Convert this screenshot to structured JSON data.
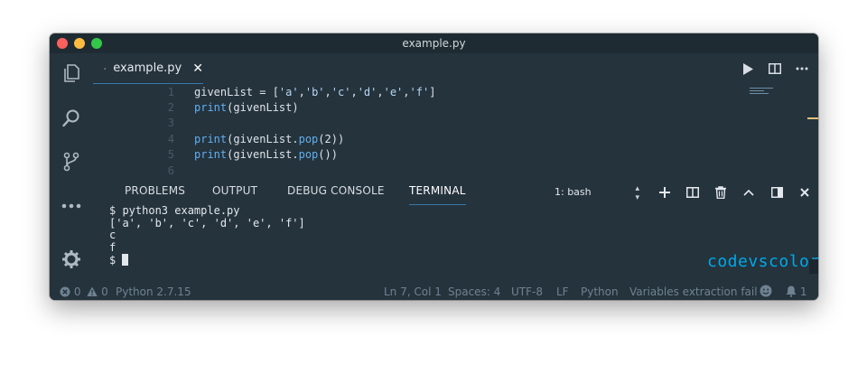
{
  "window": {
    "title": "example.py"
  },
  "tab": {
    "filename": "example.py",
    "close": "✕"
  },
  "editor": {
    "lines": [
      {
        "num": "1",
        "code": "givenList = ['a','b','c','d','e','f']"
      },
      {
        "num": "2",
        "code": "print(givenList)"
      },
      {
        "num": "3",
        "code": ""
      },
      {
        "num": "4",
        "code": "print(givenList.pop(2))"
      },
      {
        "num": "5",
        "code": "print(givenList.pop())"
      },
      {
        "num": "6",
        "code": ""
      }
    ]
  },
  "panel": {
    "tabs": [
      "PROBLEMS",
      "OUTPUT",
      "DEBUG CONSOLE",
      "TERMINAL"
    ],
    "active_tab": "TERMINAL",
    "terminal_select": "1: bash"
  },
  "terminal": {
    "lines": [
      "$ python3 example.py",
      "['a', 'b', 'c', 'd', 'e', 'f']",
      "c",
      "f",
      "$ "
    ]
  },
  "watermark": "codevscolor.com",
  "status": {
    "errors": "0",
    "warnings": "0",
    "interpreter": "Python 2.7.15",
    "position": "Ln 7, Col 1",
    "spaces": "Spaces: 4",
    "encoding": "UTF-8",
    "eol": "LF",
    "language": "Python",
    "message": "Variables extraction fail",
    "notifications": "1"
  },
  "colors": {
    "background": "#25333d",
    "accent": "#3a78a7",
    "function": "#61afef",
    "watermark": "#00a9e8"
  },
  "icons": {
    "activity": [
      "files-icon",
      "search-icon",
      "source-control-icon",
      "more-icon",
      "settings-gear-icon"
    ],
    "editor_actions": [
      "run-icon",
      "split-editor-icon",
      "more-actions-icon"
    ],
    "panel_actions": [
      "add-terminal-icon",
      "split-terminal-icon",
      "trash-icon",
      "chevron-up-icon",
      "maximize-panel-icon",
      "close-panel-icon"
    ]
  }
}
